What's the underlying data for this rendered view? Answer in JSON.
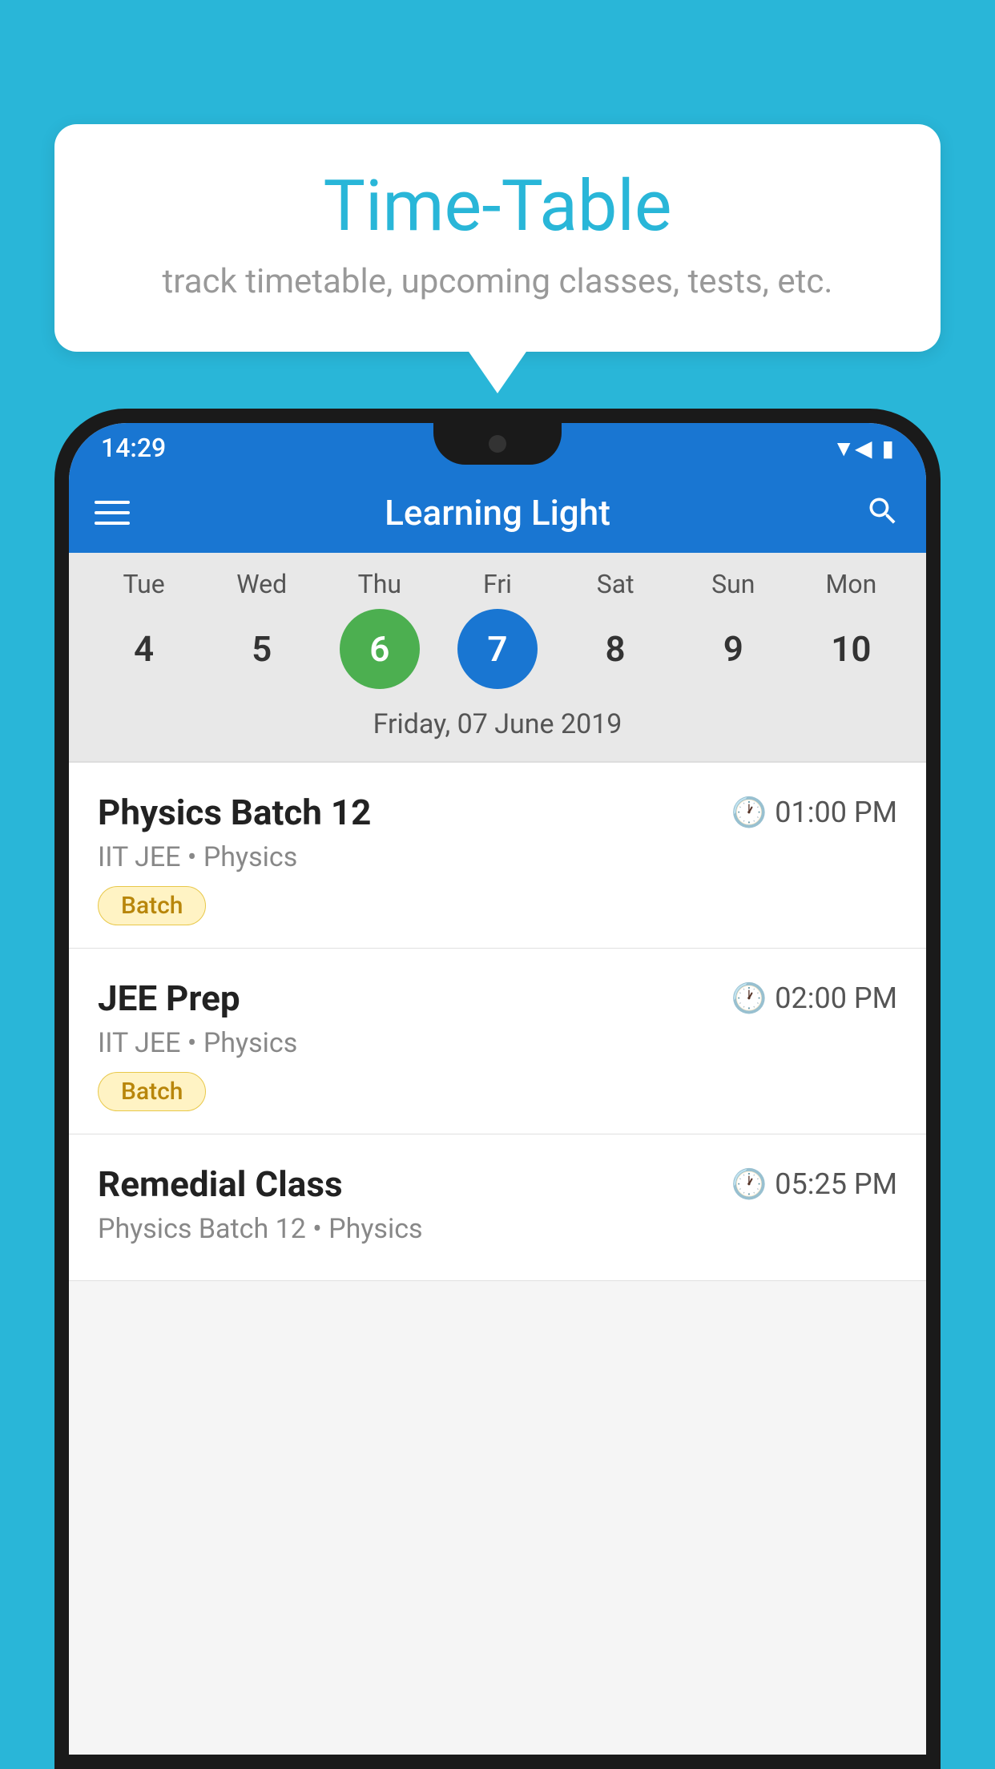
{
  "background_color": "#29B6D8",
  "bubble": {
    "title": "Time-Table",
    "subtitle": "track timetable, upcoming classes, tests, etc."
  },
  "phone": {
    "status_bar": {
      "time": "14:29",
      "icons": [
        "wifi",
        "signal",
        "battery"
      ]
    },
    "app_bar": {
      "title": "Learning Light"
    },
    "calendar": {
      "days": [
        {
          "label": "Tue",
          "number": "4",
          "state": "normal"
        },
        {
          "label": "Wed",
          "number": "5",
          "state": "normal"
        },
        {
          "label": "Thu",
          "number": "6",
          "state": "today"
        },
        {
          "label": "Fri",
          "number": "7",
          "state": "selected"
        },
        {
          "label": "Sat",
          "number": "8",
          "state": "normal"
        },
        {
          "label": "Sun",
          "number": "9",
          "state": "normal"
        },
        {
          "label": "Mon",
          "number": "10",
          "state": "normal"
        }
      ],
      "selected_date_label": "Friday, 07 June 2019"
    },
    "schedule": [
      {
        "title": "Physics Batch 12",
        "time": "01:00 PM",
        "subtitle": "IIT JEE • Physics",
        "badge": "Batch"
      },
      {
        "title": "JEE Prep",
        "time": "02:00 PM",
        "subtitle": "IIT JEE • Physics",
        "badge": "Batch"
      },
      {
        "title": "Remedial Class",
        "time": "05:25 PM",
        "subtitle": "Physics Batch 12 • Physics",
        "badge": null
      }
    ]
  }
}
